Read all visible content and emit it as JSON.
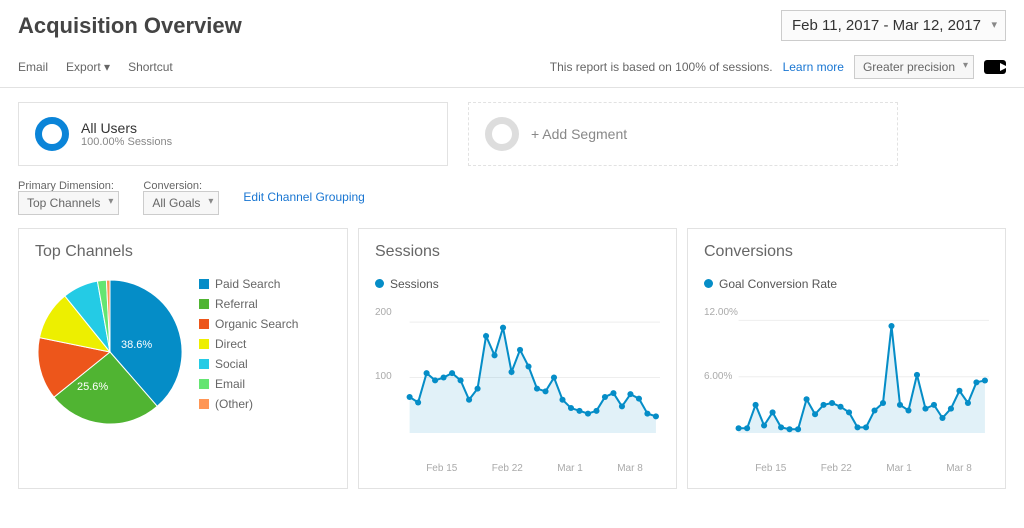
{
  "title": "Acquisition Overview",
  "date_range": "Feb 11, 2017 - Mar 12, 2017",
  "toolbar": {
    "email": "Email",
    "export": "Export",
    "shortcut": "Shortcut"
  },
  "report_note": {
    "pre": "This report is based on 100% of sessions.",
    "link": "Learn more",
    "precision": "Greater precision"
  },
  "segments": {
    "primary": {
      "name": "All Users",
      "sub": "100.00% Sessions"
    },
    "add": "+ Add Segment"
  },
  "dims": {
    "primary_lbl": "Primary Dimension:",
    "conversion_lbl": "Conversion:",
    "primary_val": "Top Channels",
    "conversion_val": "All Goals",
    "edit_link": "Edit Channel Grouping"
  },
  "panel_titles": {
    "channels": "Top Channels",
    "sessions": "Sessions",
    "conversions": "Conversions"
  },
  "series_labels": {
    "sessions": "Sessions",
    "conversions": "Goal Conversion Rate"
  },
  "pie_visible_labels": {
    "paid": "38.6%",
    "referral": "25.6%"
  },
  "chart_data": [
    {
      "type": "pie",
      "title": "Top Channels",
      "series": [
        {
          "name": "Paid Search",
          "value": 38.6,
          "color": "#058DC7"
        },
        {
          "name": "Referral",
          "value": 25.6,
          "color": "#50B432"
        },
        {
          "name": "Organic Search",
          "value": 14.0,
          "color": "#ED561B"
        },
        {
          "name": "Direct",
          "value": 11.0,
          "color": "#EDEF00"
        },
        {
          "name": "Social",
          "value": 8.0,
          "color": "#24CBE5"
        },
        {
          "name": "Email",
          "value": 2.0,
          "color": "#64E572"
        },
        {
          "name": "(Other)",
          "value": 0.8,
          "color": "#FF9655"
        }
      ]
    },
    {
      "type": "line",
      "title": "Sessions",
      "ylabel": "Sessions",
      "ylim": [
        0,
        220
      ],
      "yticks": [
        100,
        200
      ],
      "x": [
        "Feb 11",
        "Feb 12",
        "Feb 13",
        "Feb 14",
        "Feb 15",
        "Feb 16",
        "Feb 17",
        "Feb 18",
        "Feb 19",
        "Feb 20",
        "Feb 21",
        "Feb 22",
        "Feb 23",
        "Feb 24",
        "Feb 25",
        "Feb 26",
        "Feb 27",
        "Feb 28",
        "Mar 1",
        "Mar 2",
        "Mar 3",
        "Mar 4",
        "Mar 5",
        "Mar 6",
        "Mar 7",
        "Mar 8",
        "Mar 9",
        "Mar 10",
        "Mar 11",
        "Mar 12"
      ],
      "xticks": [
        "Feb 15",
        "Feb 22",
        "Mar 1",
        "Mar 8"
      ],
      "series": [
        {
          "name": "Sessions",
          "color": "#058DC7",
          "values": [
            65,
            55,
            108,
            95,
            100,
            108,
            95,
            60,
            80,
            175,
            140,
            190,
            110,
            150,
            120,
            80,
            75,
            100,
            60,
            45,
            40,
            35,
            40,
            65,
            72,
            48,
            70,
            62,
            35,
            30
          ]
        }
      ]
    },
    {
      "type": "line",
      "title": "Conversions",
      "ylabel": "Goal Conversion Rate",
      "ylim": [
        0,
        13
      ],
      "yticks": [
        6.0,
        12.0
      ],
      "ytick_labels": [
        "6.00%",
        "12.00%"
      ],
      "x": [
        "Feb 11",
        "Feb 12",
        "Feb 13",
        "Feb 14",
        "Feb 15",
        "Feb 16",
        "Feb 17",
        "Feb 18",
        "Feb 19",
        "Feb 20",
        "Feb 21",
        "Feb 22",
        "Feb 23",
        "Feb 24",
        "Feb 25",
        "Feb 26",
        "Feb 27",
        "Feb 28",
        "Mar 1",
        "Mar 2",
        "Mar 3",
        "Mar 4",
        "Mar 5",
        "Mar 6",
        "Mar 7",
        "Mar 8",
        "Mar 9",
        "Mar 10",
        "Mar 11",
        "Mar 12"
      ],
      "xticks": [
        "Feb 15",
        "Feb 22",
        "Mar 1",
        "Mar 8"
      ],
      "series": [
        {
          "name": "Goal Conversion Rate",
          "color": "#058DC7",
          "values": [
            0.5,
            0.5,
            3.0,
            0.8,
            2.2,
            0.6,
            0.4,
            0.4,
            3.6,
            2.0,
            3.0,
            3.2,
            2.8,
            2.2,
            0.6,
            0.6,
            2.4,
            3.2,
            11.4,
            3.0,
            2.4,
            6.2,
            2.6,
            3.0,
            1.6,
            2.6,
            4.5,
            3.2,
            5.4,
            5.6
          ]
        }
      ]
    }
  ]
}
